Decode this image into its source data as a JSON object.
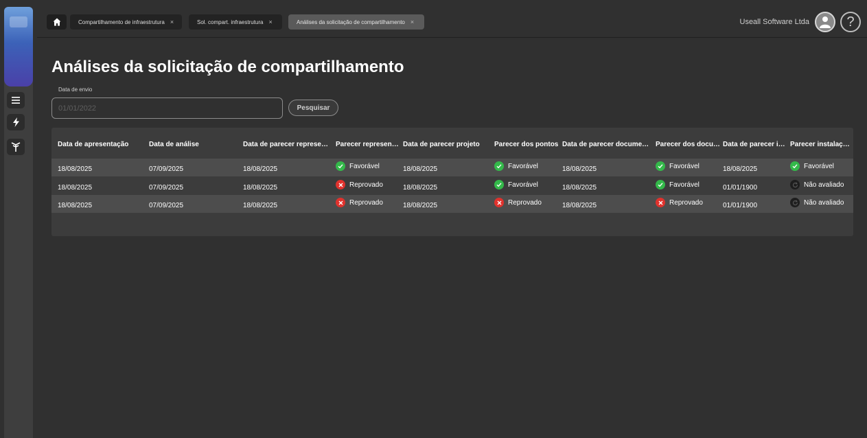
{
  "header": {
    "tabs": [
      {
        "label": "Compartilhamento de infraestrutura",
        "close": "×"
      },
      {
        "label": "Sol. compart. infraestrutura",
        "close": "×"
      },
      {
        "label": "Análises da solicitação de compartilhamento",
        "close": "×"
      }
    ],
    "company": "Useall Software Ltda",
    "help": "?"
  },
  "page": {
    "title": "Análises da solicitação de compartilhamento",
    "date_label": "Data de envio",
    "date_placeholder": "01/01/2022",
    "search_label": "Pesquisar"
  },
  "table": {
    "columns": [
      "Data de apresentação",
      "Data de análise",
      "Data de parecer representa...",
      "Parecer representa...",
      "Data de parecer projeto",
      "Parecer dos pontos",
      "Data de parecer documentos",
      "Parecer dos docum...",
      "Data de parecer ins...",
      "Parecer instalação"
    ],
    "rows": [
      [
        "18/08/2025",
        "07/09/2025",
        "18/08/2025",
        {
          "status": "ok",
          "label": "Favorável"
        },
        "18/08/2025",
        {
          "status": "ok",
          "label": "Favorável"
        },
        "18/08/2025",
        {
          "status": "ok",
          "label": "Favorável"
        },
        "18/08/2025",
        {
          "status": "ok",
          "label": "Favorável"
        }
      ],
      [
        "18/08/2025",
        "07/09/2025",
        "18/08/2025",
        {
          "status": "bad",
          "label": "Reprovado"
        },
        "18/08/2025",
        {
          "status": "ok",
          "label": "Favorável"
        },
        "18/08/2025",
        {
          "status": "ok",
          "label": "Favorável"
        },
        "01/01/1900",
        {
          "status": "na",
          "label": "Não avaliado"
        }
      ],
      [
        "18/08/2025",
        "07/09/2025",
        "18/08/2025",
        {
          "status": "bad",
          "label": "Reprovado"
        },
        "18/08/2025",
        {
          "status": "bad",
          "label": "Reprovado"
        },
        "18/08/2025",
        {
          "status": "bad",
          "label": "Reprovado"
        },
        "01/01/1900",
        {
          "status": "na",
          "label": "Não avaliado"
        }
      ]
    ]
  },
  "colors": {
    "favoravel": "#34b94a",
    "reprovado": "#e0322d",
    "nao_avaliado": "#1e1e1e"
  },
  "icons": {
    "sidebar": [
      "menu-icon",
      "lightning-icon",
      "antenna-icon"
    ],
    "status": {
      "ok": "check-icon",
      "bad": "x-icon",
      "na": "refresh-icon"
    }
  }
}
